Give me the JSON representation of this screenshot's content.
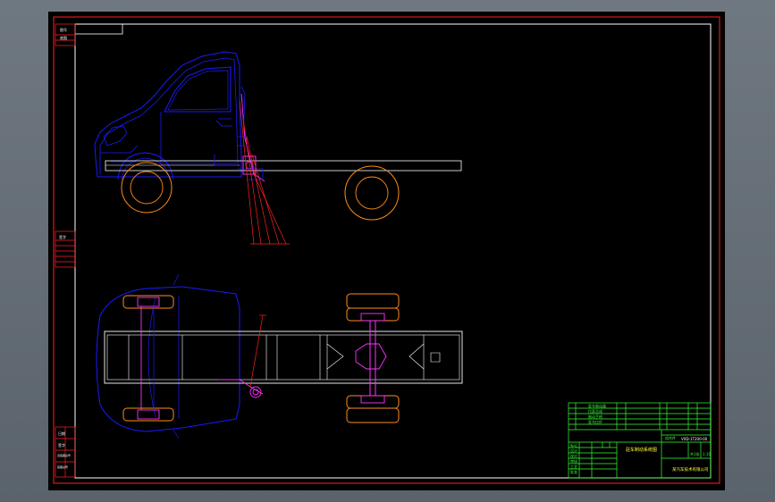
{
  "drawing": {
    "colors": {
      "background": "#000000",
      "viewport_background": "#636b73",
      "border": "#ff2020",
      "frame": "#ffffff",
      "outline": "#1a1aff",
      "wheel": "#ff8c1a",
      "component": "#ff33ff",
      "title_grid": "#33ff33"
    },
    "title_block": {
      "drawing_name": "驻车制动系统图",
      "drawing_number": "VXD-1T200-00",
      "company": "某汽车技术有限公司",
      "scale": "1:10",
      "sheet": "共1张",
      "material": "组合件",
      "row_labels": [
        "标记",
        "设计",
        "校对",
        "审核",
        "工艺",
        "批准"
      ],
      "parts_rows": [
        "驻车制动器",
        "拉索总成",
        "制动手柄",
        "驻车拉杆"
      ]
    },
    "left_strip": {
      "top_labels": [
        "图号",
        "底图"
      ],
      "mid_label": "签字",
      "bottom_labels": [
        "日期",
        "签字",
        "旧底图总号",
        "底图总号"
      ]
    }
  }
}
